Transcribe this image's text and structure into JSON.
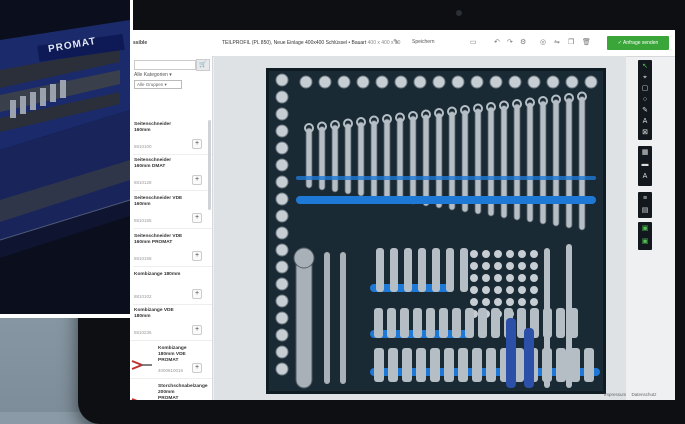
{
  "toolbar": {
    "brand": "ssible",
    "title": "TEILPROFIL (PL 850), Neue Einlage 400x400 Schlüssel • Bauart",
    "title_dims": "400 x 400 x 30",
    "save_label": "Speichern",
    "submit_label": "✓ Anfrage senden"
  },
  "panel": {
    "categories_label": "Alle Kategorien",
    "group_select": "Alle Gruppen",
    "items": [
      {
        "name": "Seitenschneider 160mm",
        "number": "8810100"
      },
      {
        "name": "Seitenschneider 160mm DMAT",
        "number": "8810128"
      },
      {
        "name": "Seitenschneider VDE 160mm",
        "number": "8810155"
      },
      {
        "name": "Seitenschneider VDE 160mm PROMAT",
        "number": "8810158"
      },
      {
        "name": "Kombizange 180mm",
        "number": "8810102"
      },
      {
        "name": "Kombizange VDE 180mm",
        "number": "8810236"
      },
      {
        "name": "Kombizange 180mm VDE PROMAT",
        "number": "4000810016"
      },
      {
        "name": "Storchschnabelzange 200mm PROMAT",
        "number": "4000810043"
      }
    ],
    "more_label": "mehr"
  },
  "overlay": {
    "brand": "PROMAT"
  },
  "footer": {
    "impressum": "Impressum",
    "datenschutz": "Datenschutz"
  },
  "colors": {
    "foam": "#1a2a34",
    "blue_accent": "#1e78d6",
    "submit_green": "#3aa63a",
    "tool_bg": "#12181d"
  },
  "icons": [
    "cursor-icon",
    "pen-icon",
    "rect-icon",
    "circle-icon",
    "line-icon",
    "text-icon",
    "layers-icon"
  ]
}
